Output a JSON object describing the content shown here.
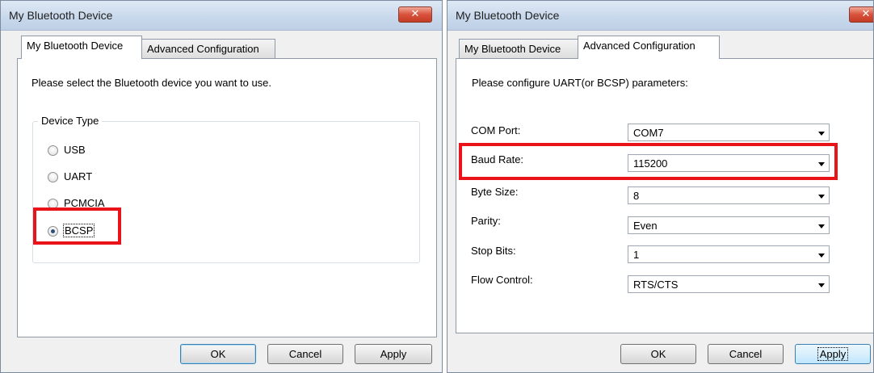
{
  "left_dialog": {
    "title": "My Bluetooth Device",
    "close_glyph": "✕",
    "tabs": [
      "My Bluetooth Device",
      "Advanced Configuration"
    ],
    "active_tab": "My Bluetooth Device",
    "instruction": "Please select the Bluetooth device you want to use.",
    "group_label": "Device Type",
    "radio_options": [
      "USB",
      "UART",
      "PCMCIA",
      "BCSP"
    ],
    "selected_option": "BCSP",
    "buttons": {
      "ok": "OK",
      "cancel": "Cancel",
      "apply": "Apply"
    },
    "highlight_color": "#e8141a"
  },
  "right_dialog": {
    "title": "My Bluetooth Device",
    "close_glyph": "✕",
    "tabs": [
      "My Bluetooth Device",
      "Advanced Configuration"
    ],
    "active_tab": "Advanced Configuration",
    "instruction": "Please configure UART(or BCSP) parameters:",
    "fields": [
      {
        "label": "COM Port:",
        "value": "COM7"
      },
      {
        "label": "Baud Rate:",
        "value": "115200"
      },
      {
        "label": "Byte Size:",
        "value": "8"
      },
      {
        "label": "Parity:",
        "value": "Even"
      },
      {
        "label": "Stop Bits:",
        "value": "1"
      },
      {
        "label": "Flow Control:",
        "value": "RTS/CTS"
      }
    ],
    "highlighted_field": "Baud Rate:",
    "buttons": {
      "ok": "OK",
      "cancel": "Cancel",
      "apply": "Apply"
    },
    "highlight_color": "#e8141a"
  }
}
